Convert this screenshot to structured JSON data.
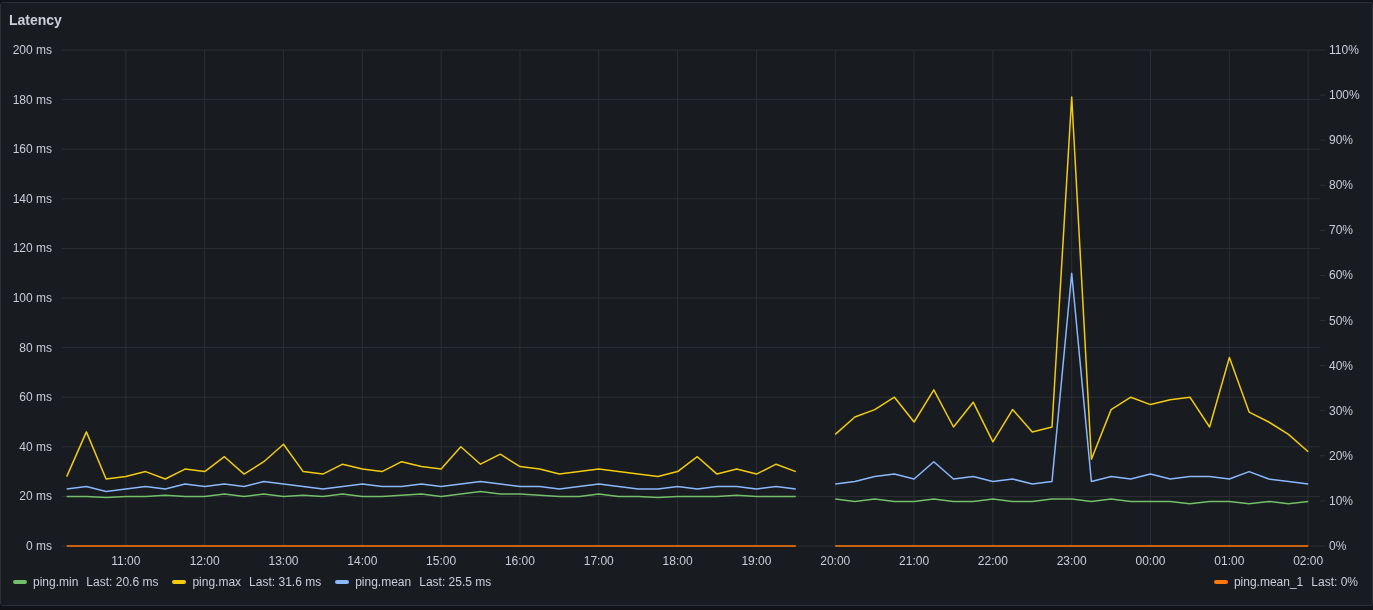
{
  "panel": {
    "title": "Latency",
    "chart_data": {
      "type": "line",
      "categories": [
        null,
        null,
        null,
        "11:00",
        null,
        null,
        null,
        "12:00",
        null,
        null,
        null,
        "13:00",
        null,
        null,
        null,
        "14:00",
        null,
        null,
        null,
        "15:00",
        null,
        null,
        null,
        "16:00",
        null,
        null,
        null,
        "17:00",
        null,
        null,
        null,
        "18:00",
        null,
        null,
        null,
        "19:00",
        null,
        null,
        null,
        "20:00",
        null,
        null,
        null,
        "21:00",
        null,
        null,
        null,
        "22:00",
        null,
        null,
        null,
        "23:00",
        null,
        null,
        null,
        "00:00",
        null,
        null,
        null,
        "01:00",
        null,
        null,
        null,
        "02:00"
      ],
      "ylim": [
        0,
        200
      ],
      "yticks": [
        {
          "value": 0,
          "label": "0 ms"
        },
        {
          "value": 20,
          "label": "20 ms"
        },
        {
          "value": 40,
          "label": "40 ms"
        },
        {
          "value": 60,
          "label": "60 ms"
        },
        {
          "value": 80,
          "label": "80 ms"
        },
        {
          "value": 100,
          "label": "100 ms"
        },
        {
          "value": 120,
          "label": "120 ms"
        },
        {
          "value": 140,
          "label": "140 ms"
        },
        {
          "value": 160,
          "label": "160 ms"
        },
        {
          "value": 180,
          "label": "180 ms"
        },
        {
          "value": 200,
          "label": "200 ms"
        }
      ],
      "y2lim": [
        0,
        110
      ],
      "y2ticks": [
        {
          "value": 0,
          "label": "0%"
        },
        {
          "value": 10,
          "label": "10%"
        },
        {
          "value": 20,
          "label": "20%"
        },
        {
          "value": 30,
          "label": "30%"
        },
        {
          "value": 40,
          "label": "40%"
        },
        {
          "value": 50,
          "label": "50%"
        },
        {
          "value": 60,
          "label": "60%"
        },
        {
          "value": 70,
          "label": "70%"
        },
        {
          "value": 80,
          "label": "80%"
        },
        {
          "value": 90,
          "label": "90%"
        },
        {
          "value": 100,
          "label": "100%"
        },
        {
          "value": 110,
          "label": "110%"
        }
      ],
      "grid": true,
      "series": [
        {
          "name": "ping.min",
          "color": "#73bf69",
          "values": [
            20,
            20,
            19.5,
            20,
            20,
            20.5,
            20,
            20,
            21,
            20,
            21,
            20,
            20.5,
            20,
            21,
            20,
            20,
            20.5,
            21,
            20,
            21,
            22,
            21,
            21,
            20.5,
            20,
            20,
            21,
            20,
            20,
            19.5,
            20,
            20,
            20,
            20.5,
            20,
            20,
            20,
            null,
            19,
            18,
            19,
            18,
            18,
            19,
            18,
            18,
            19,
            18,
            18,
            19,
            19,
            18,
            19,
            18,
            18,
            18,
            17,
            18,
            18,
            17,
            18,
            17,
            18
          ]
        },
        {
          "name": "ping.max",
          "color": "#f2cc0c",
          "values": [
            28,
            46,
            27,
            28,
            30,
            27,
            31,
            30,
            36,
            29,
            34,
            41,
            30,
            29,
            33,
            31,
            30,
            34,
            32,
            31,
            40,
            33,
            37,
            32,
            31,
            29,
            30,
            31,
            30,
            29,
            28,
            30,
            36,
            29,
            31,
            29,
            33,
            30,
            null,
            45,
            52,
            55,
            60,
            50,
            63,
            48,
            58,
            42,
            55,
            46,
            48,
            181,
            35,
            55,
            60,
            57,
            59,
            60,
            48,
            76,
            54,
            50,
            45,
            38
          ]
        },
        {
          "name": "ping.mean",
          "color": "#8ab8ff",
          "values": [
            23,
            24,
            22,
            23,
            24,
            23,
            25,
            24,
            25,
            24,
            26,
            25,
            24,
            23,
            24,
            25,
            24,
            24,
            25,
            24,
            25,
            26,
            25,
            24,
            24,
            23,
            24,
            25,
            24,
            23,
            23,
            24,
            23,
            24,
            24,
            23,
            24,
            23,
            null,
            25,
            26,
            28,
            29,
            27,
            34,
            27,
            28,
            26,
            27,
            25,
            26,
            110,
            26,
            28,
            27,
            29,
            27,
            28,
            28,
            27,
            30,
            27,
            26,
            25
          ]
        },
        {
          "name": "ping.mean_1",
          "color": "#ff780a",
          "axis": "y2",
          "values": [
            0,
            0,
            0,
            0,
            0,
            0,
            0,
            0,
            0,
            0,
            0,
            0,
            0,
            0,
            0,
            0,
            0,
            0,
            0,
            0,
            0,
            0,
            0,
            0,
            0,
            0,
            0,
            0,
            0,
            0,
            0,
            0,
            0,
            0,
            0,
            0,
            0,
            0,
            null,
            0,
            0,
            0,
            0,
            0,
            0,
            0,
            0,
            0,
            0,
            0,
            0,
            0,
            0,
            0,
            0,
            0,
            0,
            0,
            0,
            0,
            0,
            0,
            0,
            0
          ]
        }
      ]
    },
    "legend_values": [
      "Last: 20.6 ms",
      "Last: 31.6 ms",
      "Last: 25.5 ms",
      "Last: 0%"
    ]
  }
}
